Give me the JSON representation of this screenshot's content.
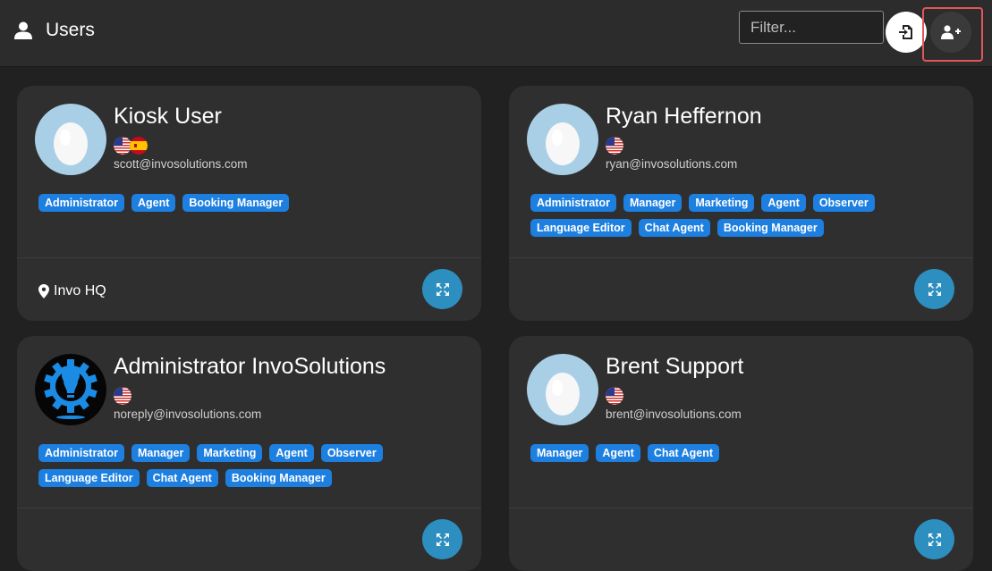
{
  "header": {
    "title": "Users",
    "filter_placeholder": "Filter...",
    "import_icon": "file-import-icon",
    "add_user_icon": "user-plus-icon"
  },
  "users": [
    {
      "name": "Kiosk User",
      "email": "scott@invosolutions.com",
      "flags": [
        "us-flag-icon",
        "es-flag-icon"
      ],
      "roles": [
        "Administrator",
        "Agent",
        "Booking Manager"
      ],
      "location": "Invo HQ",
      "avatar": "egg-avatar"
    },
    {
      "name": "Ryan Heffernon",
      "email": "ryan@invosolutions.com",
      "flags": [
        "us-flag-icon"
      ],
      "roles": [
        "Administrator",
        "Manager",
        "Marketing",
        "Agent",
        "Observer",
        "Language Editor",
        "Chat Agent",
        "Booking Manager"
      ],
      "location": "",
      "avatar": "egg-avatar"
    },
    {
      "name": "Administrator InvoSolutions",
      "email": "noreply@invosolutions.com",
      "flags": [
        "us-flag-icon"
      ],
      "roles": [
        "Administrator",
        "Manager",
        "Marketing",
        "Agent",
        "Observer",
        "Language Editor",
        "Chat Agent",
        "Booking Manager"
      ],
      "location": "",
      "avatar": "gear-bulb-logo"
    },
    {
      "name": "Brent Support",
      "email": "brent@invosolutions.com",
      "flags": [
        "us-flag-icon"
      ],
      "roles": [
        "Manager",
        "Agent",
        "Chat Agent"
      ],
      "location": "",
      "avatar": "egg-avatar"
    }
  ],
  "colors": {
    "background": "#212121",
    "card": "#2f2f2f",
    "tag": "#1d7fe0",
    "expand_button": "#2d8fbf",
    "highlight": "#e0565b"
  }
}
